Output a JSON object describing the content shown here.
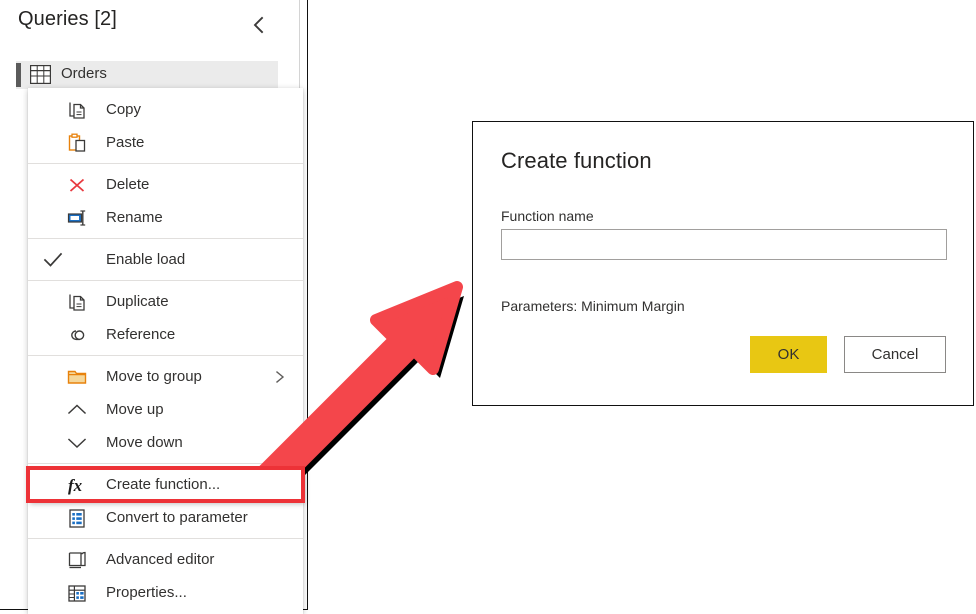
{
  "panel": {
    "title": "Queries [2]",
    "collapse_icon": "chevron-left-icon",
    "query": {
      "name": "Orders",
      "icon": "table-icon"
    }
  },
  "context_menu": {
    "groups": [
      {
        "items": [
          {
            "label": "Copy",
            "icon": "copy-icon",
            "checked": false,
            "submenu": false
          },
          {
            "label": "Paste",
            "icon": "paste-icon",
            "checked": false,
            "submenu": false
          }
        ]
      },
      {
        "items": [
          {
            "label": "Delete",
            "icon": "delete-x-icon",
            "checked": false,
            "submenu": false
          },
          {
            "label": "Rename",
            "icon": "rename-icon",
            "checked": false,
            "submenu": false
          }
        ]
      },
      {
        "items": [
          {
            "label": "Enable load",
            "icon": "checkmark-icon",
            "checked": true,
            "submenu": false
          }
        ]
      },
      {
        "items": [
          {
            "label": "Duplicate",
            "icon": "duplicate-icon",
            "checked": false,
            "submenu": false
          },
          {
            "label": "Reference",
            "icon": "reference-link-icon",
            "checked": false,
            "submenu": false
          }
        ]
      },
      {
        "items": [
          {
            "label": "Move to group",
            "icon": "folder-icon",
            "checked": false,
            "submenu": true
          },
          {
            "label": "Move up",
            "icon": "chevron-up-icon",
            "checked": false,
            "submenu": false
          },
          {
            "label": "Move down",
            "icon": "chevron-down-icon",
            "checked": false,
            "submenu": false
          }
        ]
      },
      {
        "items": [
          {
            "label": "Create function...",
            "icon": "fx-icon",
            "checked": false,
            "submenu": false,
            "highlighted": true
          },
          {
            "label": "Convert to parameter",
            "icon": "parameter-icon",
            "checked": false,
            "submenu": false
          }
        ]
      },
      {
        "items": [
          {
            "label": "Advanced editor",
            "icon": "advanced-editor-icon",
            "checked": false,
            "submenu": false
          },
          {
            "label": "Properties...",
            "icon": "properties-icon",
            "checked": false,
            "submenu": false
          }
        ]
      }
    ]
  },
  "dialog": {
    "title": "Create function",
    "function_name_label": "Function name",
    "function_name_value": "",
    "function_name_placeholder": "",
    "parameters_text": "Parameters: Minimum Margin",
    "ok_label": "OK",
    "cancel_label": "Cancel"
  },
  "annotation": {
    "arrow_icon": "red-arrow-up-right-icon",
    "highlight_color": "#ed3237",
    "arrow_color": "#f4464b"
  },
  "colors": {
    "accent_yellow": "#e8c713",
    "highlight_red": "#ed3237",
    "text": "#323130",
    "selection_gray": "#ebebeb"
  }
}
